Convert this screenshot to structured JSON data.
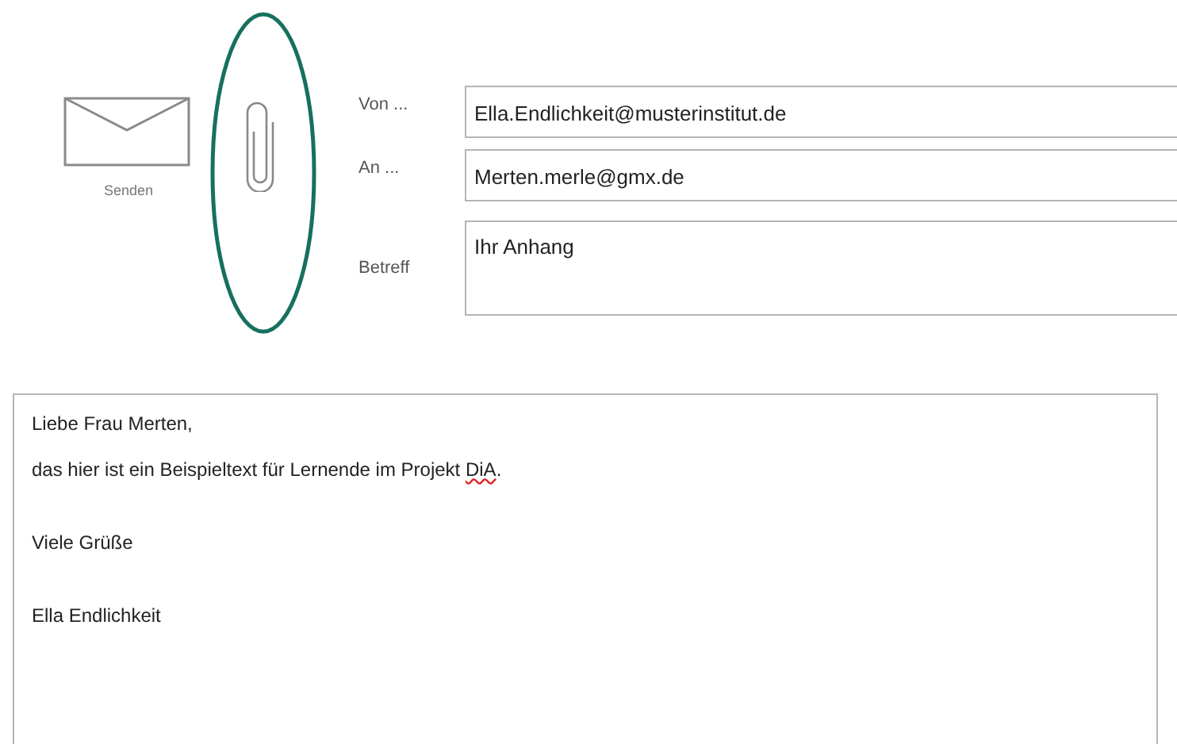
{
  "send_button": {
    "label": "Senden"
  },
  "attachment": {
    "highlighted": true
  },
  "header_fields": [
    {
      "label": "Von ...",
      "value": "Ella.Endlichkeit@musterinstitut.de",
      "kind": "single"
    },
    {
      "label": "An ...",
      "value": "Merten.merle@gmx.de",
      "kind": "single"
    },
    {
      "label": "Betreff",
      "value": "Ihr Anhang",
      "kind": "multi"
    }
  ],
  "body": {
    "lines": [
      {
        "segments": [
          {
            "text": "Liebe Frau Merten,",
            "spelling_error": false
          }
        ]
      },
      {
        "segments": [
          {
            "text": "das hier ist ein Beispieltext für Lernende im Projekt ",
            "spelling_error": false
          },
          {
            "text": "DiA",
            "spelling_error": true
          },
          {
            "text": ".",
            "spelling_error": false
          }
        ]
      },
      {
        "kind": "blank"
      },
      {
        "segments": [
          {
            "text": "Viele Grüße",
            "spelling_error": false
          }
        ]
      },
      {
        "kind": "blank"
      },
      {
        "segments": [
          {
            "text": "Ella Endlichkeit",
            "spelling_error": false
          }
        ]
      }
    ]
  }
}
